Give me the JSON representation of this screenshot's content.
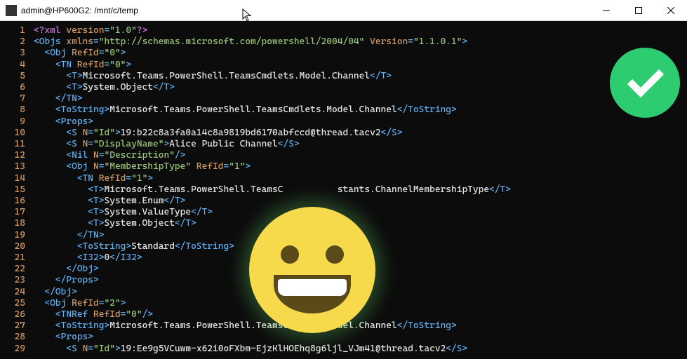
{
  "window": {
    "title": "admin@HP600G2: /mnt/c/temp"
  },
  "lines": [
    {
      "n": "1",
      "segs": [
        [
          "pi",
          "<?xml "
        ],
        [
          "attr",
          "version"
        ],
        [
          "tag",
          "="
        ],
        [
          "str",
          "\"1.0\""
        ],
        [
          "pi",
          "?>"
        ]
      ]
    },
    {
      "n": "2",
      "segs": [
        [
          "tag",
          "<Objs "
        ],
        [
          "attr",
          "xmlns"
        ],
        [
          "tag",
          "="
        ],
        [
          "str",
          "\"http://schemas.microsoft.com/powershell/2004/04\""
        ],
        [
          "tag",
          " "
        ],
        [
          "attr",
          "Version"
        ],
        [
          "tag",
          "="
        ],
        [
          "str",
          "\"1.1.0.1\""
        ],
        [
          "tag",
          ">"
        ]
      ]
    },
    {
      "n": "3",
      "segs": [
        [
          "txt",
          "  "
        ],
        [
          "tag",
          "<Obj "
        ],
        [
          "attr",
          "RefId"
        ],
        [
          "tag",
          "="
        ],
        [
          "str",
          "\"0\""
        ],
        [
          "tag",
          ">"
        ]
      ]
    },
    {
      "n": "4",
      "segs": [
        [
          "txt",
          "    "
        ],
        [
          "tag",
          "<TN "
        ],
        [
          "attr",
          "RefId"
        ],
        [
          "tag",
          "="
        ],
        [
          "str",
          "\"0\""
        ],
        [
          "tag",
          ">"
        ]
      ]
    },
    {
      "n": "5",
      "segs": [
        [
          "txt",
          "      "
        ],
        [
          "tag",
          "<T>"
        ],
        [
          "txt",
          "Microsoft.Teams.PowerShell.TeamsCmdlets.Model.Channel"
        ],
        [
          "tag",
          "</T>"
        ]
      ]
    },
    {
      "n": "6",
      "segs": [
        [
          "txt",
          "      "
        ],
        [
          "tag",
          "<T>"
        ],
        [
          "txt",
          "System.Object"
        ],
        [
          "tag",
          "</T>"
        ]
      ]
    },
    {
      "n": "7",
      "segs": [
        [
          "txt",
          "    "
        ],
        [
          "tag",
          "</TN>"
        ]
      ]
    },
    {
      "n": "8",
      "segs": [
        [
          "txt",
          "    "
        ],
        [
          "tag",
          "<ToString>"
        ],
        [
          "txt",
          "Microsoft.Teams.PowerShell.TeamsCmdlets.Model.Channel"
        ],
        [
          "tag",
          "</ToString>"
        ]
      ]
    },
    {
      "n": "9",
      "segs": [
        [
          "txt",
          "    "
        ],
        [
          "tag",
          "<Props>"
        ]
      ]
    },
    {
      "n": "10",
      "segs": [
        [
          "txt",
          "      "
        ],
        [
          "tag",
          "<S "
        ],
        [
          "attr",
          "N"
        ],
        [
          "tag",
          "="
        ],
        [
          "str",
          "\"Id\""
        ],
        [
          "tag",
          ">"
        ],
        [
          "txt",
          "19:b22c8a3fa0a14c8a9819bd6170abfccd@thread.tacv2"
        ],
        [
          "tag",
          "</S>"
        ]
      ]
    },
    {
      "n": "11",
      "segs": [
        [
          "txt",
          "      "
        ],
        [
          "tag",
          "<S "
        ],
        [
          "attr",
          "N"
        ],
        [
          "tag",
          "="
        ],
        [
          "str",
          "\"DisplayName\""
        ],
        [
          "tag",
          ">"
        ],
        [
          "txt",
          "Alice Public Channel"
        ],
        [
          "tag",
          "</S>"
        ]
      ]
    },
    {
      "n": "12",
      "segs": [
        [
          "txt",
          "      "
        ],
        [
          "tag",
          "<Nil "
        ],
        [
          "attr",
          "N"
        ],
        [
          "tag",
          "="
        ],
        [
          "str",
          "\"Description\""
        ],
        [
          "tag",
          "/>"
        ]
      ]
    },
    {
      "n": "13",
      "segs": [
        [
          "txt",
          "      "
        ],
        [
          "tag",
          "<Obj "
        ],
        [
          "attr",
          "N"
        ],
        [
          "tag",
          "="
        ],
        [
          "str",
          "\"MembershipType\""
        ],
        [
          "tag",
          " "
        ],
        [
          "attr",
          "RefId"
        ],
        [
          "tag",
          "="
        ],
        [
          "str",
          "\"1\""
        ],
        [
          "tag",
          ">"
        ]
      ]
    },
    {
      "n": "14",
      "segs": [
        [
          "txt",
          "        "
        ],
        [
          "tag",
          "<TN "
        ],
        [
          "attr",
          "RefId"
        ],
        [
          "tag",
          "="
        ],
        [
          "str",
          "\"1\""
        ],
        [
          "tag",
          ">"
        ]
      ]
    },
    {
      "n": "15",
      "segs": [
        [
          "txt",
          "          "
        ],
        [
          "tag",
          "<T>"
        ],
        [
          "txt",
          "Microsoft.Teams.PowerShell.TeamsC          stants.ChannelMembershipType"
        ],
        [
          "tag",
          "</T>"
        ]
      ]
    },
    {
      "n": "16",
      "segs": [
        [
          "txt",
          "          "
        ],
        [
          "tag",
          "<T>"
        ],
        [
          "txt",
          "System.Enum"
        ],
        [
          "tag",
          "</T>"
        ]
      ]
    },
    {
      "n": "17",
      "segs": [
        [
          "txt",
          "          "
        ],
        [
          "tag",
          "<T>"
        ],
        [
          "txt",
          "System.ValueType"
        ],
        [
          "tag",
          "</T>"
        ]
      ]
    },
    {
      "n": "18",
      "segs": [
        [
          "txt",
          "          "
        ],
        [
          "tag",
          "<T>"
        ],
        [
          "txt",
          "System.Object"
        ],
        [
          "tag",
          "</T>"
        ]
      ]
    },
    {
      "n": "19",
      "segs": [
        [
          "txt",
          "        "
        ],
        [
          "tag",
          "</TN>"
        ]
      ]
    },
    {
      "n": "20",
      "segs": [
        [
          "txt",
          "        "
        ],
        [
          "tag",
          "<ToString>"
        ],
        [
          "txt",
          "Standard"
        ],
        [
          "tag",
          "</ToString>"
        ]
      ]
    },
    {
      "n": "21",
      "segs": [
        [
          "txt",
          "        "
        ],
        [
          "tag",
          "<I32>"
        ],
        [
          "txt",
          "0"
        ],
        [
          "tag",
          "</I32>"
        ]
      ]
    },
    {
      "n": "22",
      "segs": [
        [
          "txt",
          "      "
        ],
        [
          "tag",
          "</Obj>"
        ]
      ]
    },
    {
      "n": "23",
      "segs": [
        [
          "txt",
          "    "
        ],
        [
          "tag",
          "</Props>"
        ]
      ]
    },
    {
      "n": "24",
      "segs": [
        [
          "txt",
          "  "
        ],
        [
          "tag",
          "</Obj>"
        ]
      ]
    },
    {
      "n": "25",
      "segs": [
        [
          "txt",
          "  "
        ],
        [
          "tag",
          "<Obj "
        ],
        [
          "attr",
          "RefId"
        ],
        [
          "tag",
          "="
        ],
        [
          "str",
          "\"2\""
        ],
        [
          "tag",
          ">"
        ]
      ]
    },
    {
      "n": "26",
      "segs": [
        [
          "txt",
          "    "
        ],
        [
          "tag",
          "<TNRef "
        ],
        [
          "attr",
          "RefId"
        ],
        [
          "tag",
          "="
        ],
        [
          "str",
          "\"0\""
        ],
        [
          "tag",
          "/>"
        ]
      ]
    },
    {
      "n": "27",
      "segs": [
        [
          "txt",
          "    "
        ],
        [
          "tag",
          "<ToString>"
        ],
        [
          "txt",
          "Microsoft.Teams.PowerShell.TeamsCmdlets.Model.Channel"
        ],
        [
          "tag",
          "</ToString>"
        ]
      ]
    },
    {
      "n": "28",
      "segs": [
        [
          "txt",
          "    "
        ],
        [
          "tag",
          "<Props>"
        ]
      ]
    },
    {
      "n": "29",
      "segs": [
        [
          "txt",
          "      "
        ],
        [
          "tag",
          "<S "
        ],
        [
          "attr",
          "N"
        ],
        [
          "tag",
          "="
        ],
        [
          "str",
          "\"Id\""
        ],
        [
          "tag",
          ">"
        ],
        [
          "txt",
          "19:Ee9g5VCuwm-x62i0oFXbm-EjzKlHOEhq8g6ljl_VJm41@thread.tacv2"
        ],
        [
          "tag",
          "</S>"
        ]
      ]
    }
  ]
}
